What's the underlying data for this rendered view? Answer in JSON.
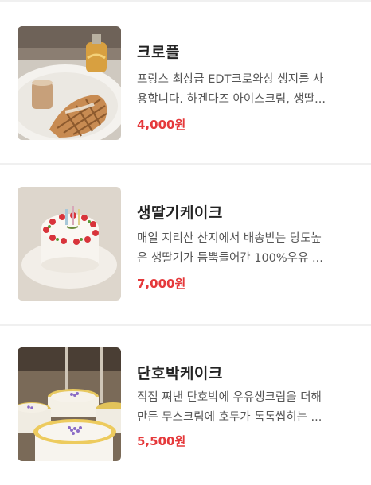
{
  "menu": {
    "items": [
      {
        "title": "크로플",
        "desc_line1": "프랑스 최상급 EDT크로와상 생지를 사",
        "desc_line2": "용합니다. 하겐다즈 아이스크림, 생딸...",
        "price": "4,000원",
        "image_icon": "croffle-photo"
      },
      {
        "title": "생딸기케이크",
        "desc_line1": "매일 지리산 산지에서 배송받는 당도높",
        "desc_line2": "은 생딸기가 듬뿍들어간 100%우유 ...",
        "price": "7,000원",
        "image_icon": "strawberry-cake-photo"
      },
      {
        "title": "단호박케이크",
        "desc_line1": "직접 쪄낸 단호박에 우유생크림을 더해",
        "desc_line2": "만든 무스크림에 호두가 톡톡씹히는 ...",
        "price": "5,500원",
        "image_icon": "pumpkin-cake-photo"
      }
    ]
  },
  "colors": {
    "price": "#e5393b",
    "title": "#222222",
    "desc": "#555555",
    "divider": "#f0f0f0"
  }
}
